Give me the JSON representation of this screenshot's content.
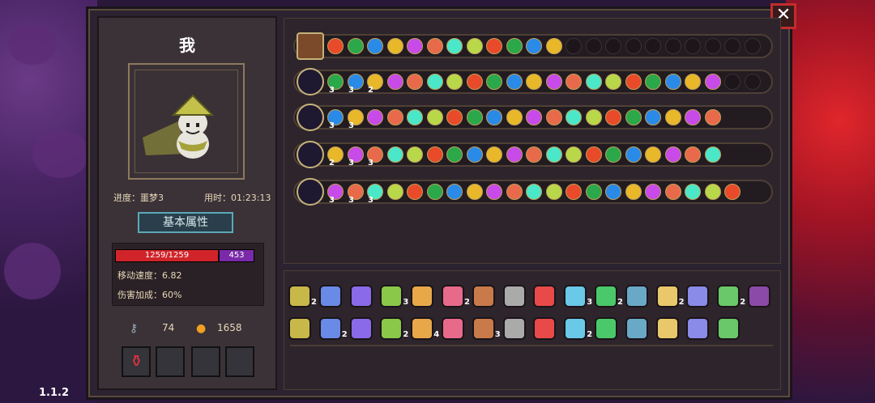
{
  "player": {
    "name": "我",
    "progress_label": "进度：噩梦3",
    "time_label": "用时：01:23:13",
    "attr_button": "基本属性",
    "hp": "1259/1259",
    "shield": "453",
    "move_speed": "移动速度：6.82",
    "damage_bonus": "伤害加成：60%",
    "keys": "74",
    "gold": "1658"
  },
  "version": "1.1.2",
  "close_label": "✕",
  "equip_rows": [
    {
      "filled": 12,
      "total": 22
    },
    {
      "filled": 20,
      "total": 22,
      "counts": [
        "3",
        "3",
        "2"
      ]
    },
    {
      "filled": 20,
      "total": 20,
      "counts": [
        "3",
        "3"
      ]
    },
    {
      "filled": 20,
      "total": 20,
      "counts": [
        "2",
        "3",
        "3"
      ]
    },
    {
      "filled": 21,
      "total": 21,
      "counts": [
        "3",
        "3",
        "3"
      ]
    }
  ],
  "items_row1": [
    {
      "icon": "straw-hat-icon",
      "count": "2"
    },
    {
      "icon": "crystal-drop-icon",
      "count": ""
    },
    {
      "icon": "cloak-icon",
      "count": ""
    },
    {
      "icon": "dagger-icon",
      "count": "3"
    },
    {
      "icon": "cup-icon",
      "count": ""
    },
    {
      "icon": "potion-icon",
      "count": "2"
    },
    {
      "icon": "wand-icon",
      "count": ""
    },
    {
      "icon": "glasses-icon",
      "count": ""
    },
    {
      "icon": "feather-icon",
      "count": ""
    },
    {
      "icon": "cloud-icon",
      "count": "3"
    },
    {
      "icon": "leaf-icon",
      "count": "2"
    },
    {
      "icon": "orb-icon",
      "count": ""
    },
    {
      "icon": "horn-icon",
      "count": "2"
    },
    {
      "icon": "shell-icon",
      "count": ""
    },
    {
      "icon": "bird-icon",
      "count": "2"
    },
    {
      "icon": "bat-icon",
      "count": ""
    }
  ],
  "items_row2": [
    {
      "icon": "boot-icon",
      "count": ""
    },
    {
      "icon": "magnifier-icon",
      "count": "2"
    },
    {
      "icon": "star-shard-icon",
      "count": ""
    },
    {
      "icon": "scroll-icon",
      "count": "2"
    },
    {
      "icon": "belt-icon",
      "count": "4"
    },
    {
      "icon": "lantern-icon",
      "count": ""
    },
    {
      "icon": "trident-icon",
      "count": "3"
    },
    {
      "icon": "pig-icon",
      "count": ""
    },
    {
      "icon": "teeth-icon",
      "count": ""
    },
    {
      "icon": "clover-icon",
      "count": "2"
    },
    {
      "icon": "spider-icon",
      "count": ""
    },
    {
      "icon": "lotus-icon",
      "count": ""
    },
    {
      "icon": "arrow-icon",
      "count": ""
    },
    {
      "icon": "fish-icon",
      "count": ""
    },
    {
      "icon": "hourglass-icon",
      "count": ""
    }
  ],
  "colors": {
    "accent": "#c5b27a",
    "hp": "#d0242a",
    "shield": "#7a2aa8"
  }
}
